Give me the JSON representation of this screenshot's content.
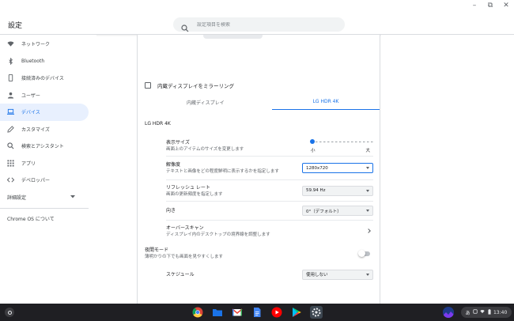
{
  "window": {
    "title": "設定",
    "controls": [
      "minimize-icon",
      "maximize-icon",
      "close-icon"
    ]
  },
  "search": {
    "placeholder": "設定項目を検索"
  },
  "sidebar": {
    "items": [
      {
        "label": "ネットワーク",
        "icon": "wifi-icon",
        "active": false
      },
      {
        "label": "Bluetooth",
        "icon": "bluetooth-icon",
        "active": false
      },
      {
        "label": "接続済みのデバイス",
        "icon": "phone-icon",
        "active": false
      },
      {
        "label": "ユーザー",
        "icon": "person-icon",
        "active": false
      },
      {
        "label": "デバイス",
        "icon": "laptop-icon",
        "active": true
      },
      {
        "label": "カスタマイズ",
        "icon": "pencil-icon",
        "active": false
      },
      {
        "label": "検索とアシスタント",
        "icon": "search-icon",
        "active": false
      },
      {
        "label": "アプリ",
        "icon": "apps-grid-icon",
        "active": false
      },
      {
        "label": "デベロッパー",
        "icon": "code-icon",
        "active": false
      }
    ],
    "advanced_label": "詳細設定",
    "about_label": "Chrome OS について"
  },
  "display": {
    "mirror_label": "内蔵ディスプレイをミラーリング",
    "mirror_checked": false,
    "tabs": [
      {
        "label": "内蔵ディスプレイ",
        "selected": false
      },
      {
        "label": "LG HDR 4K",
        "selected": true
      }
    ],
    "section_title": "LG HDR 4K",
    "display_size": {
      "label": "表示サイズ",
      "sub": "画面上のアイテムのサイズを変更します",
      "min_label": "小",
      "max_label": "大",
      "level": 0.0
    },
    "resolution": {
      "label": "解像度",
      "sub": "テキストと画像をどの程度鮮明に表示するかを指定します",
      "value": "1280x720"
    },
    "refresh_rate": {
      "label": "リフレッシュ レート",
      "sub": "画面の更新頻度を指定します",
      "value": "59.94 Hz"
    },
    "orientation": {
      "label": "向き",
      "value": "0°（デフォルト）"
    },
    "overscan": {
      "label": "オーバースキャン",
      "sub": "ディスプレイ内のデスクトップの境界線を調整します"
    },
    "night_light": {
      "label": "夜間モード",
      "sub": "薄明かりの下でも画面を見やすくします",
      "enabled": false
    },
    "schedule": {
      "label": "スケジュール",
      "value": "使用しない"
    }
  },
  "shelf": {
    "apps": [
      "chrome-icon",
      "files-icon",
      "gmail-icon",
      "docs-icon",
      "youtube-icon",
      "play-store-icon",
      "settings-icon"
    ],
    "status": {
      "ime": "あ",
      "time": "13:40"
    }
  },
  "colors": {
    "accent": "#1a73e8",
    "active_bg": "#e8f0fe",
    "shelf_bg": "#1f1f23"
  }
}
